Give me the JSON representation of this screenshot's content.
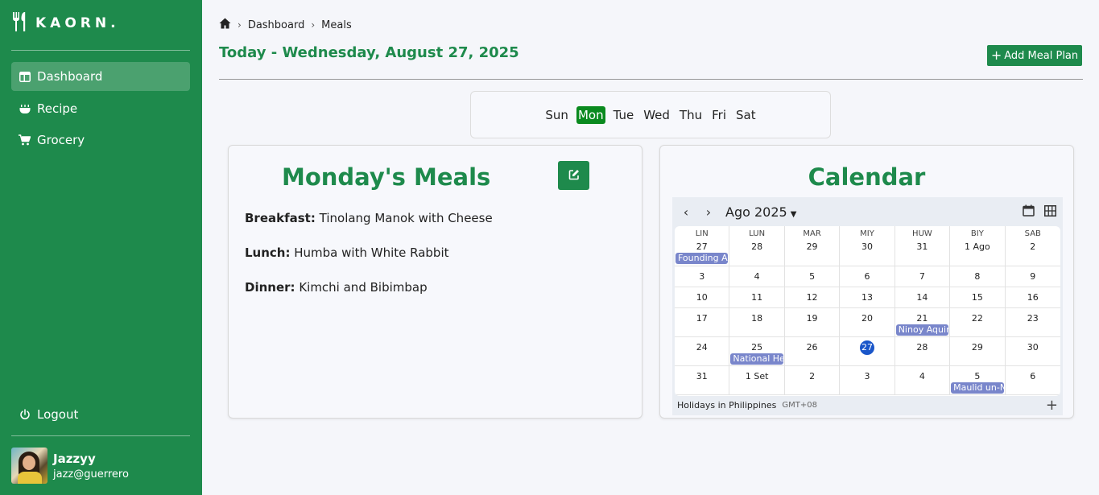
{
  "app": {
    "logo_text": "KAORN."
  },
  "sidebar": {
    "items": [
      {
        "label": "Dashboard",
        "icon": "dashboard-icon",
        "active": true
      },
      {
        "label": "Recipe",
        "icon": "pot-icon",
        "active": false
      },
      {
        "label": "Grocery",
        "icon": "cart-icon",
        "active": false
      }
    ],
    "logout_label": "Logout",
    "user": {
      "name": "Jazzyy",
      "email": "jazz@guerrero"
    }
  },
  "breadcrumb": [
    "Dashboard",
    "Meals"
  ],
  "header": {
    "title": "Today - Wednesday, August 27, 2025",
    "add_button_label": "Add Meal Plan"
  },
  "days": [
    "Sun",
    "Mon",
    "Tue",
    "Wed",
    "Thu",
    "Fri",
    "Sat"
  ],
  "selected_day": "Mon",
  "meals": {
    "title": "Monday's Meals",
    "items": [
      {
        "label": "Breakfast:",
        "value": "Tinolang Manok with Cheese"
      },
      {
        "label": "Lunch:",
        "value": "Humba with White Rabbit"
      },
      {
        "label": "Dinner:",
        "value": "Kimchi and Bibimbap"
      }
    ]
  },
  "calendar": {
    "title": "Calendar",
    "month_label": "Ago 2025",
    "weekdays": [
      "LIN",
      "LUN",
      "MAR",
      "MIY",
      "HUW",
      "BIY",
      "SAB"
    ],
    "weeks": [
      [
        "27",
        "28",
        "29",
        "30",
        "31",
        "1 Ago",
        "2"
      ],
      [
        "3",
        "4",
        "5",
        "6",
        "7",
        "8",
        "9"
      ],
      [
        "10",
        "11",
        "12",
        "13",
        "14",
        "15",
        "16"
      ],
      [
        "17",
        "18",
        "19",
        "20",
        "21",
        "22",
        "23"
      ],
      [
        "24",
        "25",
        "26",
        "27",
        "28",
        "29",
        "30"
      ],
      [
        "31",
        "1 Set",
        "2",
        "3",
        "4",
        "5",
        "6"
      ]
    ],
    "today": {
      "week": 4,
      "day": 3
    },
    "events": [
      {
        "week": 0,
        "day": 0,
        "label": "Founding Ar"
      },
      {
        "week": 3,
        "day": 4,
        "label": "Ninoy Aquin"
      },
      {
        "week": 4,
        "day": 1,
        "label": "National Her"
      },
      {
        "week": 5,
        "day": 5,
        "label": "Maulid un-N"
      }
    ],
    "footer_label": "Holidays in Philippines",
    "timezone": "GMT+08",
    "event_color": "#7986cb",
    "today_color": "#1a56c9"
  },
  "colors": {
    "brand": "#1e8a4c",
    "active_day": "#0a8a1f"
  }
}
